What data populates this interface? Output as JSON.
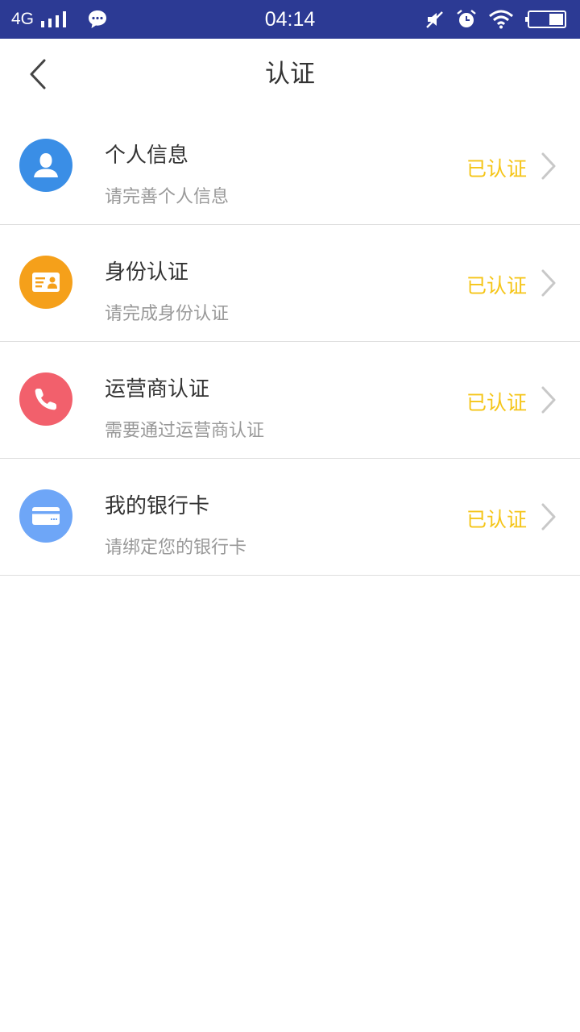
{
  "status_bar": {
    "network": "4G",
    "time": "04:14",
    "icons": [
      "signal-icon",
      "message-icon",
      "mute-icon",
      "alarm-icon",
      "wifi-icon",
      "battery-icon"
    ]
  },
  "header": {
    "title": "认证",
    "back_icon": "back-arrow-icon"
  },
  "colors": {
    "status_bar_bg": "#2c3a94",
    "status_text": "#f5c518",
    "divider": "#dedede"
  },
  "items": [
    {
      "title": "个人信息",
      "subtitle": "请完善个人信息",
      "status": "已认证",
      "icon": "person-icon",
      "icon_color": "#3a8ee6"
    },
    {
      "title": "身份认证",
      "subtitle": "请完成身份认证",
      "status": "已认证",
      "icon": "id-card-icon",
      "icon_color": "#f5a01a"
    },
    {
      "title": "运营商认证",
      "subtitle": "需要通过运营商认证",
      "status": "已认证",
      "icon": "phone-icon",
      "icon_color": "#f2606c"
    },
    {
      "title": "我的银行卡",
      "subtitle": "请绑定您的银行卡",
      "status": "已认证",
      "icon": "bank-card-icon",
      "icon_color": "#6ea6f7"
    }
  ]
}
